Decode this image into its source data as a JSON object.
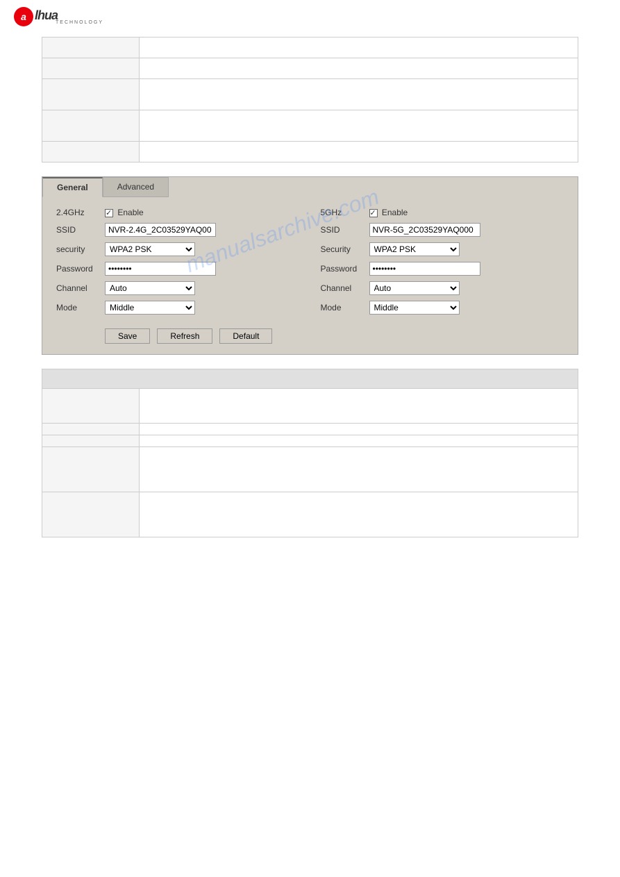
{
  "logo": {
    "letter": "a",
    "brand": "lhua",
    "subtitle": "TECHNOLOGY"
  },
  "top_table": {
    "rows": [
      {
        "col1": "",
        "col2": ""
      },
      {
        "col1": "",
        "col2": ""
      },
      {
        "col1": "",
        "col2": ""
      },
      {
        "col1": "",
        "col2": ""
      },
      {
        "col1": "",
        "col2": ""
      }
    ]
  },
  "wifi_panel": {
    "tab_general": "General",
    "tab_advanced": "Advanced",
    "band_24": {
      "label": "2.4GHz",
      "enable_label": "Enable",
      "ssid_label": "SSID",
      "ssid_value": "NVR-2.4G_2C03529YAQ00",
      "security_label": "Security",
      "security_value": "WPA2 PSK",
      "password_label": "Password",
      "password_value": "••••••••",
      "channel_label": "Channel",
      "channel_value": "Auto",
      "mode_label": "Mode",
      "mode_value": "Middle"
    },
    "band_5": {
      "label": "5GHz",
      "enable_label": "Enable",
      "ssid_label": "SSID",
      "ssid_value": "NVR-5G_2C03529YAQ000",
      "security_label": "Security",
      "security_value": "WPA2 PSK",
      "password_label": "Password",
      "password_value": "••••••••",
      "channel_label": "Channel",
      "channel_value": "Auto",
      "mode_label": "Mode",
      "mode_value": "Middle"
    },
    "btn_save": "Save",
    "btn_refresh": "Refresh",
    "btn_default": "Default"
  },
  "bottom_table": {
    "header": "",
    "rows": [
      {
        "col1": "",
        "col2": "",
        "tall": false
      },
      {
        "col1": "",
        "col2": "",
        "tall": true
      },
      {
        "col1": "",
        "col2": "",
        "tall": false
      },
      {
        "col1": "",
        "col2": "",
        "tall": false
      },
      {
        "col1": "",
        "col2": "",
        "tall": true
      },
      {
        "col1": "",
        "col2": "",
        "tall": true
      }
    ]
  },
  "security_label": "security"
}
